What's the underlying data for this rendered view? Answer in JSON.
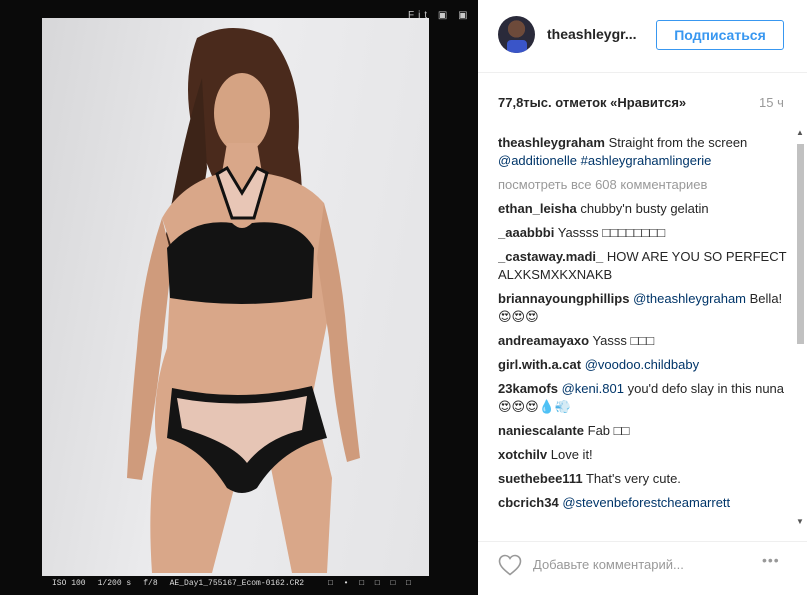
{
  "camera": {
    "top_icons": "Fit ▣ ▣",
    "iso": "ISO 100",
    "shutter": "1/200 s",
    "aperture": "f/8",
    "filename": "AE_Day1_755167_Ecom-0162.CR2",
    "strip_icons": "□ • □ □ □ □"
  },
  "post": {
    "username": "theashleygr...",
    "follow_label": "Подписаться",
    "likes": "77,8тыс. отметок «Нравится»",
    "time": "15 ч"
  },
  "caption": {
    "user": "theashleygraham",
    "text": "Straight from the screen",
    "mention": "@additionelle",
    "hashtag": "#ashleygrahamlingerie"
  },
  "view_all": "посмотреть все 608 комментариев",
  "comments": [
    {
      "user": "ethan_leisha",
      "text": "chubby'n busty gelatin"
    },
    {
      "user": "_aaabbbi",
      "text": "Yassss □□□□□□□□"
    },
    {
      "user": "_castaway.madi_",
      "text": "HOW ARE YOU SO PERFECT ALXKSMXKXNAKB"
    },
    {
      "user": "briannayoungphillips",
      "mention": "@theashleygraham",
      "text": "Bella!😍😍😍"
    },
    {
      "user": "andreamayaxo",
      "text": "Yasss □□□"
    },
    {
      "user": "girl.with.a.cat",
      "mention": "@voodoo.childbaby",
      "text": ""
    },
    {
      "user": "23kamofs",
      "mention": "@keni.801",
      "text": "you'd defo slay in this nuna 😍😍😍💧💨"
    },
    {
      "user": "naniescalante",
      "text": "Fab □□"
    },
    {
      "user": "xotchilv",
      "text": "Love it!"
    },
    {
      "user": "suethebee111",
      "text": "That's very cute."
    },
    {
      "user": "cbcrich34",
      "mention": "@stevenbeforestcheamarrett",
      "text": ""
    }
  ],
  "footer": {
    "comment_placeholder": "Добавьте комментарий...",
    "more_icon": "•••"
  },
  "icons": {
    "heart": "heart-outline-icon",
    "more": "more-options-icon"
  }
}
